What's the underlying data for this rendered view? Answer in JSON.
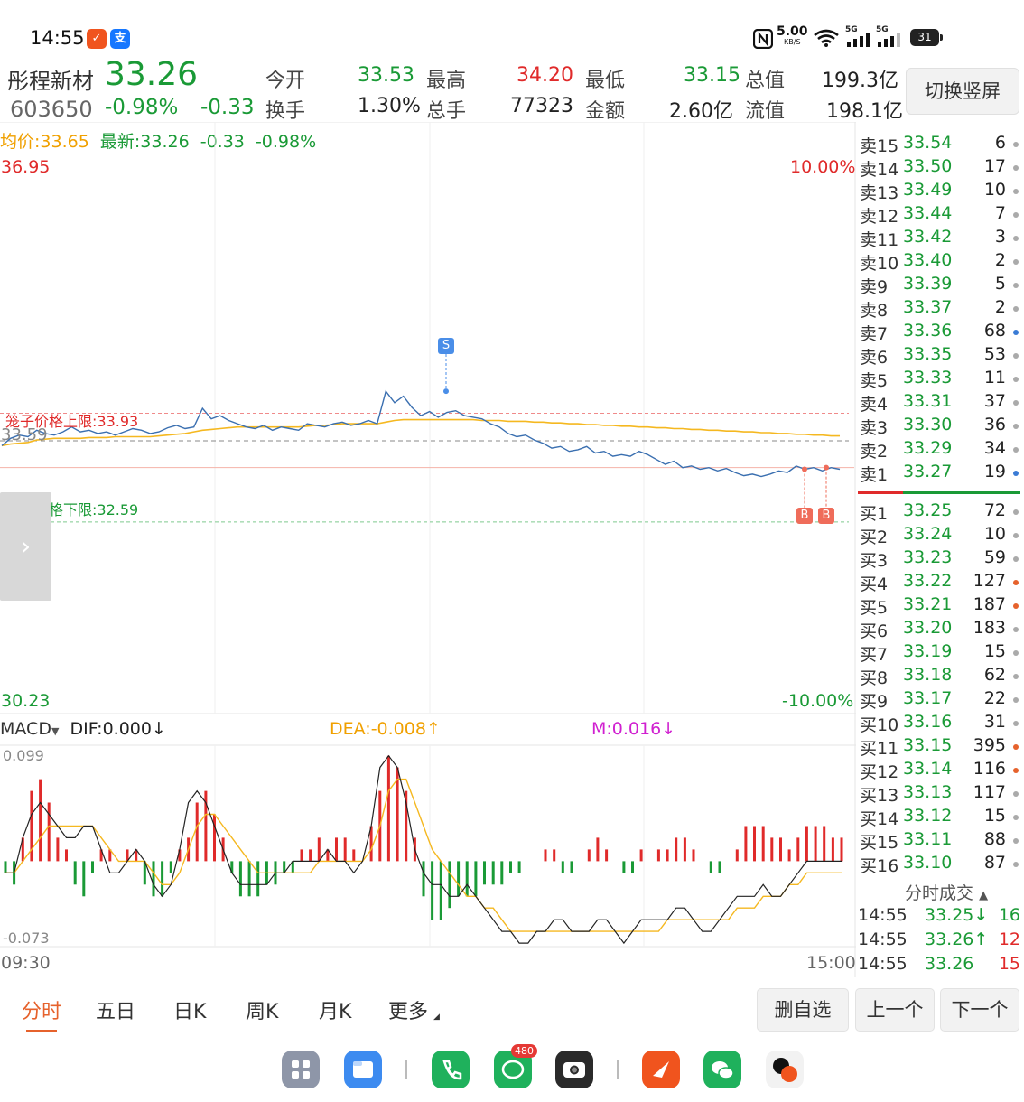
{
  "status_bar": {
    "time": "14:55",
    "speed_value": "5.00",
    "speed_unit": "KB/S",
    "net_label_1": "5G",
    "net_label_2": "5G",
    "battery": "31"
  },
  "quote": {
    "name": "彤程新材",
    "code": "603650",
    "price": "33.26",
    "change_pct": "-0.98%",
    "change": "-0.33",
    "open_label": "今开",
    "open": "33.53",
    "high_label": "最高",
    "high": "34.20",
    "low_label": "最低",
    "low": "33.15",
    "mktcap_label": "总值",
    "mktcap": "199.3亿",
    "turnover_label": "换手",
    "turnover": "1.30%",
    "volume_label": "总手",
    "volume": "77323",
    "amount_label": "金额",
    "amount": "2.60亿",
    "float_label": "流值",
    "float_cap": "198.1亿",
    "switch_button": "切换竖屏"
  },
  "chart_header": {
    "avg_label": "均价:",
    "avg": "33.65",
    "latest_label": "最新:",
    "latest": "33.26",
    "change": "-0.33",
    "change_pct": "-0.98%"
  },
  "chart_labels": {
    "y_top": "36.95",
    "y_bottom": "30.23",
    "pct_top": "10.00%",
    "pct_bottom": "-10.00%",
    "cage_upper": "笼子价格上限:33.93",
    "cage_lower": "笼子价格下限:32.59",
    "prev_close": "33.59",
    "sell_marker": "S",
    "buy_marker_1": "B",
    "buy_marker_2": "B",
    "time_start": "09:30",
    "time_end": "15:00",
    "macd_name": "MACD",
    "dif": "DIF:0.000↓",
    "dea": "DEA:-0.008↑",
    "m": "M:0.016↓",
    "macd_top": "0.099",
    "macd_bottom": "-0.073",
    "side_arrow": "›"
  },
  "colors": {
    "up": "#e02a2a",
    "down": "#1a9a36",
    "price_line": "#3a6fb0",
    "avg_line": "#f5b820",
    "accent": "#e6622c"
  },
  "chart_data": {
    "type": "line",
    "x_range": [
      "09:30",
      "15:00"
    ],
    "ylim": [
      30.23,
      36.95
    ],
    "pct_range": [
      "-10.00%",
      "10.00%"
    ],
    "prev_close": 33.59,
    "cage_upper": 33.93,
    "cage_lower": 32.59,
    "price_series": [
      33.53,
      33.62,
      33.66,
      33.64,
      33.72,
      33.68,
      33.66,
      33.7,
      33.76,
      33.7,
      33.72,
      33.68,
      33.7,
      33.66,
      33.7,
      33.74,
      33.72,
      33.68,
      33.7,
      33.75,
      33.78,
      33.74,
      33.76,
      33.99,
      33.86,
      33.9,
      33.84,
      33.8,
      33.76,
      33.74,
      33.78,
      33.72,
      33.76,
      33.74,
      33.72,
      33.8,
      33.78,
      33.76,
      33.8,
      33.82,
      33.78,
      33.8,
      33.84,
      33.8,
      34.2,
      34.06,
      34.14,
      34.0,
      33.9,
      33.95,
      33.88,
      33.94,
      33.96,
      33.9,
      33.88,
      33.86,
      33.8,
      33.76,
      33.68,
      33.64,
      33.66,
      33.6,
      33.56,
      33.5,
      33.52,
      33.46,
      33.48,
      33.52,
      33.44,
      33.46,
      33.4,
      33.42,
      33.4,
      33.46,
      33.42,
      33.36,
      33.3,
      33.34,
      33.26,
      33.28,
      33.24,
      33.26,
      33.22,
      33.25,
      33.2,
      33.16,
      33.18,
      33.15,
      33.18,
      33.22,
      33.2,
      33.28,
      33.24,
      33.26,
      33.22,
      33.26,
      33.24
    ],
    "avg_series": [
      33.53,
      33.55,
      33.56,
      33.57,
      33.6,
      33.61,
      33.62,
      33.62,
      33.62,
      33.62,
      33.63,
      33.63,
      33.63,
      33.64,
      33.64,
      33.64,
      33.64,
      33.64,
      33.65,
      33.66,
      33.67,
      33.68,
      33.7,
      33.72,
      33.73,
      33.74,
      33.75,
      33.76,
      33.76,
      33.76,
      33.76,
      33.76,
      33.76,
      33.76,
      33.76,
      33.77,
      33.78,
      33.78,
      33.79,
      33.8,
      33.8,
      33.8,
      33.8,
      33.8,
      33.82,
      33.84,
      33.85,
      33.85,
      33.85,
      33.85,
      33.85,
      33.85,
      33.85,
      33.85,
      33.85,
      33.84,
      33.84,
      33.84,
      33.83,
      33.83,
      33.83,
      33.82,
      33.82,
      33.81,
      33.81,
      33.8,
      33.8,
      33.79,
      33.79,
      33.78,
      33.78,
      33.77,
      33.77,
      33.76,
      33.76,
      33.75,
      33.75,
      33.74,
      33.74,
      33.73,
      33.73,
      33.72,
      33.72,
      33.71,
      33.71,
      33.7,
      33.7,
      33.69,
      33.69,
      33.68,
      33.68,
      33.67,
      33.67,
      33.66,
      33.66,
      33.65,
      33.65
    ],
    "macd_ylim": [
      -0.073,
      0.099
    ],
    "macd_hist": [
      -0.01,
      -0.02,
      0.02,
      0.06,
      0.07,
      0.05,
      0.02,
      0.01,
      -0.02,
      -0.03,
      -0.01,
      0.01,
      0.01,
      0.0,
      0.01,
      0.01,
      -0.02,
      -0.03,
      -0.03,
      -0.01,
      0.01,
      0.02,
      0.05,
      0.06,
      0.04,
      0.02,
      -0.01,
      -0.03,
      -0.03,
      -0.03,
      -0.02,
      -0.02,
      -0.01,
      -0.01,
      0.01,
      0.01,
      0.02,
      0.01,
      0.02,
      0.02,
      0.01,
      0.0,
      0.03,
      0.06,
      0.09,
      0.08,
      0.06,
      0.02,
      -0.03,
      -0.05,
      -0.05,
      -0.04,
      -0.03,
      -0.03,
      -0.03,
      -0.02,
      -0.02,
      -0.02,
      -0.01,
      -0.01,
      -0.0,
      0.0,
      0.01,
      0.01,
      -0.01,
      -0.01,
      0.0,
      0.01,
      0.02,
      0.01,
      0.0,
      -0.01,
      -0.01,
      0.01,
      0.0,
      0.01,
      0.01,
      0.02,
      0.02,
      0.01,
      -0.0,
      -0.01,
      -0.01,
      -0.0,
      0.01,
      0.03,
      0.03,
      0.03,
      0.02,
      0.02,
      0.01,
      0.02,
      0.03,
      0.03,
      0.03,
      0.02,
      0.02
    ],
    "dif_series": [
      -0.01,
      -0.01,
      0.02,
      0.04,
      0.05,
      0.04,
      0.03,
      0.02,
      0.02,
      0.03,
      0.03,
      0.01,
      -0.01,
      -0.01,
      0.0,
      0.01,
      0.0,
      -0.02,
      -0.03,
      -0.02,
      0.01,
      0.05,
      0.06,
      0.05,
      0.03,
      0.01,
      -0.01,
      -0.02,
      -0.02,
      -0.02,
      -0.02,
      -0.01,
      -0.01,
      0.0,
      -0.0,
      -0.0,
      0.0,
      0.01,
      0.0,
      -0.0,
      -0.01,
      -0.0,
      0.03,
      0.08,
      0.09,
      0.08,
      0.05,
      0.01,
      -0.01,
      -0.02,
      -0.02,
      -0.03,
      -0.03,
      -0.02,
      -0.03,
      -0.04,
      -0.05,
      -0.06,
      -0.06,
      -0.07,
      -0.07,
      -0.06,
      -0.06,
      -0.05,
      -0.05,
      -0.06,
      -0.06,
      -0.06,
      -0.05,
      -0.05,
      -0.06,
      -0.07,
      -0.06,
      -0.05,
      -0.05,
      -0.05,
      -0.05,
      -0.04,
      -0.04,
      -0.05,
      -0.06,
      -0.06,
      -0.05,
      -0.04,
      -0.03,
      -0.03,
      -0.03,
      -0.02,
      -0.03,
      -0.03,
      -0.02,
      -0.01,
      0.0,
      0.0,
      0.0,
      0.0,
      0.0
    ],
    "dea_series": [
      -0.01,
      -0.01,
      0.0,
      0.01,
      0.02,
      0.03,
      0.03,
      0.03,
      0.03,
      0.03,
      0.03,
      0.02,
      0.01,
      0.0,
      0.0,
      -0.0,
      -0.0,
      -0.01,
      -0.02,
      -0.02,
      -0.01,
      0.01,
      0.03,
      0.04,
      0.04,
      0.03,
      0.02,
      0.01,
      -0.0,
      -0.01,
      -0.01,
      -0.01,
      -0.01,
      -0.01,
      -0.01,
      -0.01,
      -0.0,
      0.0,
      0.0,
      0.0,
      -0.0,
      -0.0,
      0.01,
      0.03,
      0.06,
      0.07,
      0.07,
      0.05,
      0.03,
      0.01,
      -0.0,
      -0.01,
      -0.02,
      -0.03,
      -0.03,
      -0.04,
      -0.04,
      -0.05,
      -0.06,
      -0.06,
      -0.06,
      -0.06,
      -0.06,
      -0.06,
      -0.06,
      -0.06,
      -0.06,
      -0.06,
      -0.06,
      -0.06,
      -0.06,
      -0.06,
      -0.06,
      -0.06,
      -0.06,
      -0.06,
      -0.05,
      -0.05,
      -0.05,
      -0.05,
      -0.05,
      -0.05,
      -0.05,
      -0.05,
      -0.04,
      -0.04,
      -0.04,
      -0.03,
      -0.03,
      -0.03,
      -0.02,
      -0.02,
      -0.01,
      -0.01,
      -0.01,
      -0.01,
      -0.01
    ]
  },
  "order_book": {
    "asks": [
      {
        "label": "卖15",
        "price": "33.54",
        "vol": "6",
        "dot": "#aaaaaa"
      },
      {
        "label": "卖14",
        "price": "33.50",
        "vol": "17",
        "dot": "#aaaaaa"
      },
      {
        "label": "卖13",
        "price": "33.49",
        "vol": "10",
        "dot": "#aaaaaa"
      },
      {
        "label": "卖12",
        "price": "33.44",
        "vol": "7",
        "dot": "#aaaaaa"
      },
      {
        "label": "卖11",
        "price": "33.42",
        "vol": "3",
        "dot": "#aaaaaa"
      },
      {
        "label": "卖10",
        "price": "33.40",
        "vol": "2",
        "dot": "#aaaaaa"
      },
      {
        "label": "卖9",
        "price": "33.39",
        "vol": "5",
        "dot": "#aaaaaa"
      },
      {
        "label": "卖8",
        "price": "33.37",
        "vol": "2",
        "dot": "#aaaaaa"
      },
      {
        "label": "卖7",
        "price": "33.36",
        "vol": "68",
        "dot": "#3a7bd5"
      },
      {
        "label": "卖6",
        "price": "33.35",
        "vol": "53",
        "dot": "#aaaaaa"
      },
      {
        "label": "卖5",
        "price": "33.33",
        "vol": "11",
        "dot": "#aaaaaa"
      },
      {
        "label": "卖4",
        "price": "33.31",
        "vol": "37",
        "dot": "#aaaaaa"
      },
      {
        "label": "卖3",
        "price": "33.30",
        "vol": "36",
        "dot": "#aaaaaa"
      },
      {
        "label": "卖2",
        "price": "33.29",
        "vol": "34",
        "dot": "#aaaaaa"
      },
      {
        "label": "卖1",
        "price": "33.27",
        "vol": "19",
        "dot": "#3a7bd5"
      }
    ],
    "bids": [
      {
        "label": "买1",
        "price": "33.25",
        "vol": "72",
        "dot": "#aaaaaa"
      },
      {
        "label": "买2",
        "price": "33.24",
        "vol": "10",
        "dot": "#aaaaaa"
      },
      {
        "label": "买3",
        "price": "33.23",
        "vol": "59",
        "dot": "#aaaaaa"
      },
      {
        "label": "买4",
        "price": "33.22",
        "vol": "127",
        "dot": "#e6622c"
      },
      {
        "label": "买5",
        "price": "33.21",
        "vol": "187",
        "dot": "#e6622c"
      },
      {
        "label": "买6",
        "price": "33.20",
        "vol": "183",
        "dot": "#aaaaaa"
      },
      {
        "label": "买7",
        "price": "33.19",
        "vol": "15",
        "dot": "#aaaaaa"
      },
      {
        "label": "买8",
        "price": "33.18",
        "vol": "62",
        "dot": "#aaaaaa"
      },
      {
        "label": "买9",
        "price": "33.17",
        "vol": "22",
        "dot": "#aaaaaa"
      },
      {
        "label": "买10",
        "price": "33.16",
        "vol": "31",
        "dot": "#aaaaaa"
      },
      {
        "label": "买11",
        "price": "33.15",
        "vol": "395",
        "dot": "#e6622c"
      },
      {
        "label": "买12",
        "price": "33.14",
        "vol": "116",
        "dot": "#e6622c"
      },
      {
        "label": "买13",
        "price": "33.13",
        "vol": "117",
        "dot": "#aaaaaa"
      },
      {
        "label": "买14",
        "price": "33.12",
        "vol": "15",
        "dot": "#aaaaaa"
      },
      {
        "label": "买15",
        "price": "33.11",
        "vol": "88",
        "dot": "#aaaaaa"
      },
      {
        "label": "买16",
        "price": "33.10",
        "vol": "87",
        "dot": "#aaaaaa"
      }
    ]
  },
  "ticks": {
    "title": "分时成交",
    "rows": [
      {
        "time": "14:55",
        "price": "33.25↓",
        "vol": "16",
        "vol_color": "#1a9a36"
      },
      {
        "time": "14:55",
        "price": "33.26↑",
        "vol": "12",
        "vol_color": "#e02a2a"
      },
      {
        "time": "14:55",
        "price": "33.26",
        "vol": "15",
        "vol_color": "#e02a2a"
      }
    ]
  },
  "tabs": [
    "分时",
    "五日",
    "日K",
    "周K",
    "月K",
    "更多"
  ],
  "actions": {
    "remove_watch": "删自选",
    "prev": "上一个",
    "next": "下一个"
  },
  "dock": {
    "badge": "480"
  }
}
